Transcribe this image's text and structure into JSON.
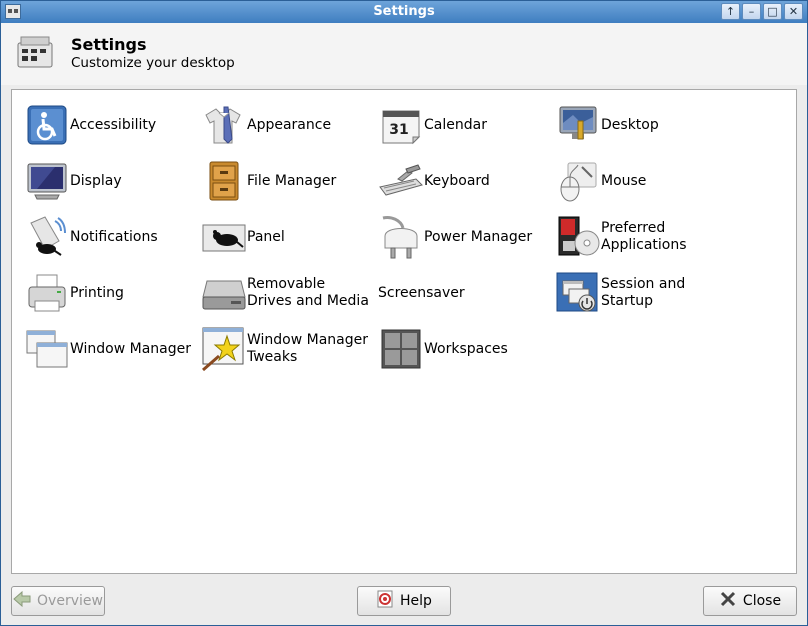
{
  "window": {
    "title": "Settings"
  },
  "titlebar_buttons": [
    "↑",
    "–",
    "□",
    "✕"
  ],
  "header": {
    "title": "Settings",
    "subtitle": "Customize your desktop"
  },
  "items": [
    {
      "label": "Accessibility",
      "icon": "accessibility-icon"
    },
    {
      "label": "Appearance",
      "icon": "appearance-icon"
    },
    {
      "label": "Calendar",
      "icon": "calendar-icon"
    },
    {
      "label": "Desktop",
      "icon": "desktop-icon"
    },
    {
      "label": "Display",
      "icon": "display-icon"
    },
    {
      "label": "File Manager",
      "icon": "file-manager-icon"
    },
    {
      "label": "Keyboard",
      "icon": "keyboard-icon"
    },
    {
      "label": "Mouse",
      "icon": "mouse-icon"
    },
    {
      "label": "Notifications",
      "icon": "notifications-icon"
    },
    {
      "label": "Panel",
      "icon": "panel-icon"
    },
    {
      "label": "Power Manager",
      "icon": "power-manager-icon"
    },
    {
      "label": "Preferred Applications",
      "icon": "preferred-applications-icon"
    },
    {
      "label": "Printing",
      "icon": "printer-icon"
    },
    {
      "label": "Removable Drives and Media",
      "icon": "removable-drive-icon"
    },
    {
      "label": "Screensaver",
      "icon": ""
    },
    {
      "label": "Session and Startup",
      "icon": "session-startup-icon"
    },
    {
      "label": "Window Manager",
      "icon": "window-manager-icon"
    },
    {
      "label": "Window Manager Tweaks",
      "icon": "window-manager-tweaks-icon"
    },
    {
      "label": "Workspaces",
      "icon": "workspaces-icon"
    }
  ],
  "calendar_day": "31",
  "footer": {
    "overview": "Overview",
    "help": "Help",
    "close": "Close"
  }
}
